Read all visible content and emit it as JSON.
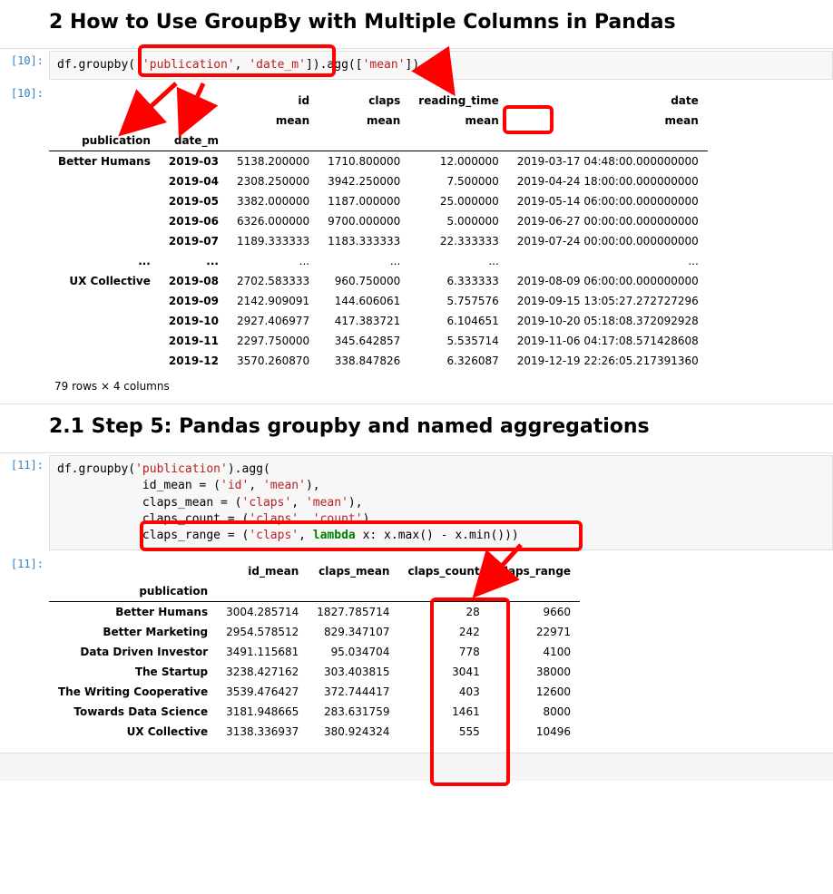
{
  "section2": {
    "heading": "2  How to Use GroupBy with Multiple Columns in Pandas"
  },
  "cell10": {
    "prompt_in": "[10]:",
    "prompt_out": "[10]:",
    "code": {
      "p1": "df.groupby([",
      "s1": "'publication'",
      "comma": ", ",
      "s2": "'date_m'",
      "p2": "]).agg([",
      "s3": "'mean'",
      "p3": "])"
    },
    "headers_top": {
      "c1": "id",
      "c2": "claps",
      "c3": "reading_time",
      "c4": "date"
    },
    "headers_sub": {
      "c1": "mean",
      "c2": "mean",
      "c3": "mean",
      "c4": "mean"
    },
    "index_names": {
      "i1": "publication",
      "i2": "date_m"
    },
    "rows": [
      {
        "pub": "Better Humans",
        "dm": "2019-03",
        "id": "5138.200000",
        "claps": "1710.800000",
        "rt": "12.000000",
        "date": "2019-03-17 04:48:00.000000000"
      },
      {
        "pub": "",
        "dm": "2019-04",
        "id": "2308.250000",
        "claps": "3942.250000",
        "rt": "7.500000",
        "date": "2019-04-24 18:00:00.000000000"
      },
      {
        "pub": "",
        "dm": "2019-05",
        "id": "3382.000000",
        "claps": "1187.000000",
        "rt": "25.000000",
        "date": "2019-05-14 06:00:00.000000000"
      },
      {
        "pub": "",
        "dm": "2019-06",
        "id": "6326.000000",
        "claps": "9700.000000",
        "rt": "5.000000",
        "date": "2019-06-27 00:00:00.000000000"
      },
      {
        "pub": "",
        "dm": "2019-07",
        "id": "1189.333333",
        "claps": "1183.333333",
        "rt": "22.333333",
        "date": "2019-07-24 00:00:00.000000000"
      },
      {
        "pub": "...",
        "dm": "...",
        "id": "...",
        "claps": "...",
        "rt": "...",
        "date": "..."
      },
      {
        "pub": "UX Collective",
        "dm": "2019-08",
        "id": "2702.583333",
        "claps": "960.750000",
        "rt": "6.333333",
        "date": "2019-08-09 06:00:00.000000000"
      },
      {
        "pub": "",
        "dm": "2019-09",
        "id": "2142.909091",
        "claps": "144.606061",
        "rt": "5.757576",
        "date": "2019-09-15 13:05:27.272727296"
      },
      {
        "pub": "",
        "dm": "2019-10",
        "id": "2927.406977",
        "claps": "417.383721",
        "rt": "6.104651",
        "date": "2019-10-20 05:18:08.372092928"
      },
      {
        "pub": "",
        "dm": "2019-11",
        "id": "2297.750000",
        "claps": "345.642857",
        "rt": "5.535714",
        "date": "2019-11-06 04:17:08.571428608"
      },
      {
        "pub": "",
        "dm": "2019-12",
        "id": "3570.260870",
        "claps": "338.847826",
        "rt": "6.326087",
        "date": "2019-12-19 22:26:05.217391360"
      }
    ],
    "caption": "79 rows × 4 columns"
  },
  "section21": {
    "heading": "2.1  Step 5: Pandas groupby and named aggregations"
  },
  "cell11": {
    "prompt_in": "[11]:",
    "prompt_out": "[11]:",
    "code": {
      "l1a": "df.groupby(",
      "l1s": "'publication'",
      "l1b": ").agg(",
      "l2a": "            id_mean = (",
      "l2s1": "'id'",
      "l2b": ", ",
      "l2s2": "'mean'",
      "l2c": "),",
      "l3a": "            claps_mean = (",
      "l3s1": "'claps'",
      "l3b": ", ",
      "l3s2": "'mean'",
      "l3c": "),",
      "l4a": "            claps_count = (",
      "l4s1": "'claps'",
      "l4b": ", ",
      "l4s2": "'count'",
      "l4c": "),",
      "l5a": "            claps_range = (",
      "l5s1": "'claps'",
      "l5b": ", ",
      "l5kw": "lambda",
      "l5c": " x: x.max() - x.min()))"
    },
    "headers": {
      "c1": "id_mean",
      "c2": "claps_mean",
      "c3": "claps_count",
      "c4": "claps_range"
    },
    "index_name": "publication",
    "rows": [
      {
        "pub": "Better Humans",
        "c1": "3004.285714",
        "c2": "1827.785714",
        "c3": "28",
        "c4": "9660"
      },
      {
        "pub": "Better Marketing",
        "c1": "2954.578512",
        "c2": "829.347107",
        "c3": "242",
        "c4": "22971"
      },
      {
        "pub": "Data Driven Investor",
        "c1": "3491.115681",
        "c2": "95.034704",
        "c3": "778",
        "c4": "4100"
      },
      {
        "pub": "The Startup",
        "c1": "3238.427162",
        "c2": "303.403815",
        "c3": "3041",
        "c4": "38000"
      },
      {
        "pub": "The Writing Cooperative",
        "c1": "3539.476427",
        "c2": "372.744417",
        "c3": "403",
        "c4": "12600"
      },
      {
        "pub": "Towards Data Science",
        "c1": "3181.948665",
        "c2": "283.631759",
        "c3": "1461",
        "c4": "8000"
      },
      {
        "pub": "UX Collective",
        "c1": "3138.336937",
        "c2": "380.924324",
        "c3": "555",
        "c4": "10496"
      }
    ]
  }
}
